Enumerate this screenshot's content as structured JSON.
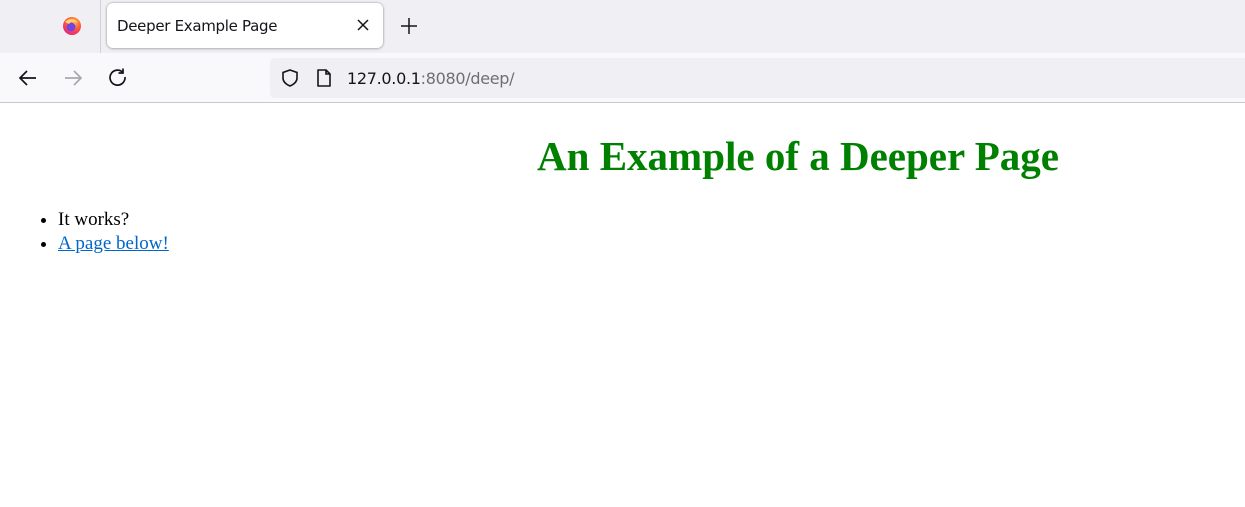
{
  "browser": {
    "tab": {
      "title": "Deeper Example Page"
    },
    "url": {
      "host": "127.0.0.1",
      "rest": ":8080/deep/"
    }
  },
  "page": {
    "heading": "An Example of a Deeper Page",
    "heading_color": "#008000",
    "items": [
      {
        "text": "It works?",
        "link": false
      },
      {
        "text": "A page below!",
        "link": true
      }
    ],
    "link_color": "#0066cc"
  }
}
